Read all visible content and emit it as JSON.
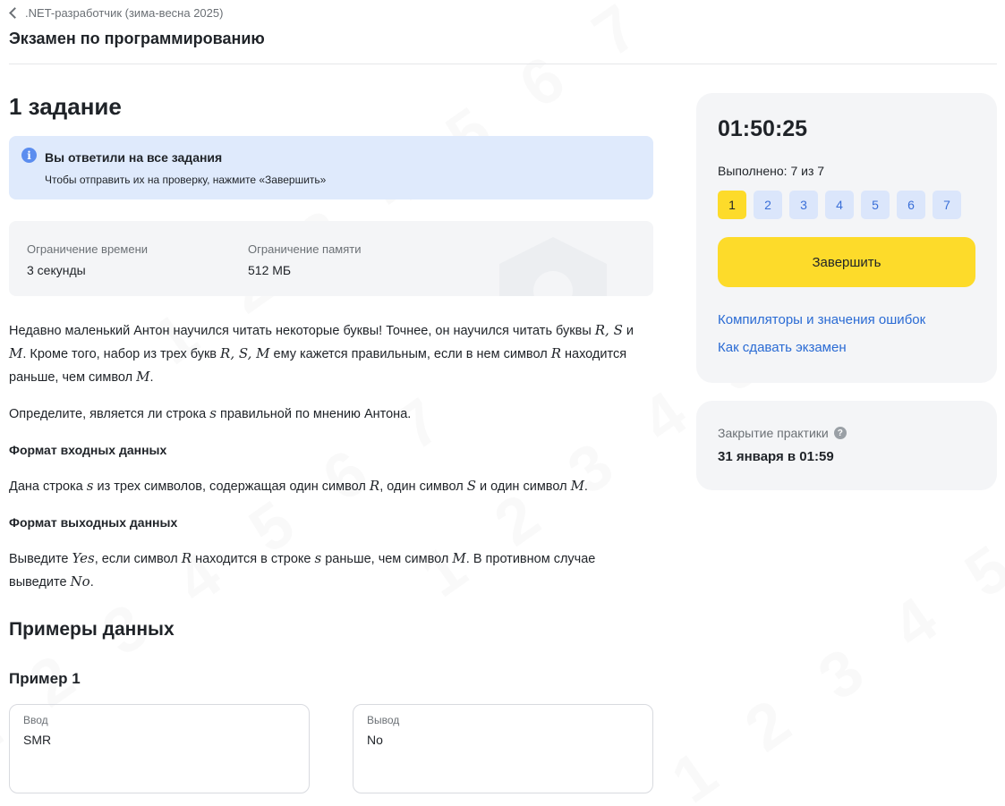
{
  "breadcrumb": {
    "label": ".NET-разработчик (зима-весна 2025)"
  },
  "page": {
    "title": "Экзамен по программированию"
  },
  "task": {
    "title": "1 задание",
    "notice": {
      "title": "Вы ответили на все задания",
      "text": "Чтобы отправить их на проверку, нажмите «Завершить»"
    },
    "limits": {
      "time_label": "Ограничение времени",
      "time_value": "3 секунды",
      "memory_label": "Ограничение памяти",
      "memory_value": "512 МБ"
    },
    "statement": {
      "p1_a": "Недавно маленький Антон научился читать некоторые буквы! Точнее, он научился читать буквы ",
      "p1_b": " и ",
      "p1_c": ". Кроме того, набор из трех букв ",
      "p1_d": " ему кажется правильным, если в нем символ ",
      "p1_e": " находится раньше, чем символ ",
      "p1_f": ".",
      "p2_a": "Определите, является ли строка ",
      "p2_b": " правильной по мнению Антона.",
      "input_header": "Формат входных данных",
      "p3_a": "Дана строка ",
      "p3_b": " из трех символов, содержащая один символ ",
      "p3_c": ", один символ ",
      "p3_d": " и один символ ",
      "p3_e": ".",
      "output_header": "Формат выходных данных",
      "p4_a": "Выведите ",
      "p4_b": ", если символ ",
      "p4_c": " находится в строке ",
      "p4_d": " раньше, чем символ ",
      "p4_e": ". В противном случае выведите ",
      "p4_f": ".",
      "var_R": "R",
      "var_S": "S",
      "var_M": "M",
      "var_s": "s",
      "var_RS": "R, S",
      "var_RSM": "R, S, M",
      "var_yes": "Yes",
      "var_no": "No"
    },
    "examples_title": "Примеры данных",
    "example1": {
      "title": "Пример 1",
      "input_label": "Ввод",
      "input_value": "SMR",
      "output_label": "Вывод",
      "output_value": "No"
    }
  },
  "sidebar": {
    "timer": "01:50:25",
    "progress": "Выполнено: 7 из 7",
    "tasks": [
      "1",
      "2",
      "3",
      "4",
      "5",
      "6",
      "7"
    ],
    "active_task": "1",
    "finish_label": "Завершить",
    "link_compilers": "Компиляторы и значения ошибок",
    "link_howto": "Как сдавать экзамен",
    "close_label": "Закрытие практики",
    "close_date": "31 января в 01:59"
  },
  "colors": {
    "accent_yellow": "#fddb2a",
    "link_blue": "#2a6bd4",
    "notice_bg": "#dfeafc",
    "card_bg": "#f4f5f7"
  }
}
